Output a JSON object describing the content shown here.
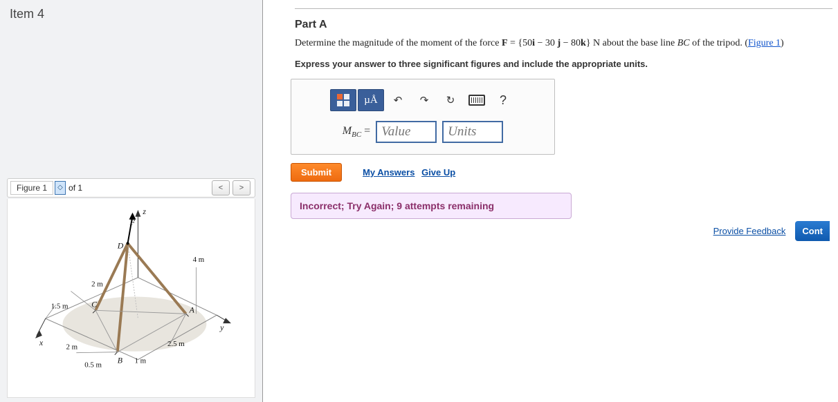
{
  "item_title": "Item 4",
  "figure_bar": {
    "label": "Figure 1",
    "selector_glyph": "◇",
    "of_text": "of 1",
    "prev_glyph": "<",
    "next_glyph": ">"
  },
  "figure": {
    "axis_z": "z",
    "axis_y": "y",
    "axis_x": "x",
    "label_F": "F",
    "label_D": "D",
    "label_C": "C",
    "label_A": "A",
    "label_B": "B",
    "dim_2m_a": "2 m",
    "dim_1_5m": "1.5 m",
    "dim_2m_b": "2 m",
    "dim_0_5m": "0.5 m",
    "dim_1m": "1 m",
    "dim_2_5m": "2.5 m",
    "dim_4m": "4 m"
  },
  "part": {
    "title": "Part A",
    "prompt_pre": "Determine the magnitude of the moment of the force ",
    "prompt_force_sym": "F",
    "prompt_eq": " = {50",
    "prompt_i": "i",
    "prompt_m1": " − 30",
    "prompt_j": " j",
    "prompt_m2": " − 80",
    "prompt_k": "k",
    "prompt_post": "} N about the base line ",
    "prompt_bc": "BC",
    "prompt_tail": " of the tripod. (",
    "prompt_link": "Figure 1",
    "prompt_close": ")",
    "instructions": "Express your answer to three significant figures and include the appropriate units."
  },
  "toolbar": {
    "templates_name": "templates-icon",
    "units_label": "µÅ",
    "undo_glyph": "↶",
    "redo_glyph": "↷",
    "reset_glyph": "↻",
    "keyboard_name": "keyboard-icon",
    "help_glyph": "?"
  },
  "answer": {
    "var_label_M": "M",
    "var_label_sub": "BC",
    "equals": " = ",
    "value_placeholder": "Value",
    "units_placeholder": "Units"
  },
  "actions": {
    "submit": "Submit",
    "my_answers": "My Answers",
    "give_up": "Give Up"
  },
  "feedback": "Incorrect; Try Again; 9 attempts remaining",
  "footer": {
    "provide_feedback": "Provide Feedback",
    "continue": "Cont"
  }
}
